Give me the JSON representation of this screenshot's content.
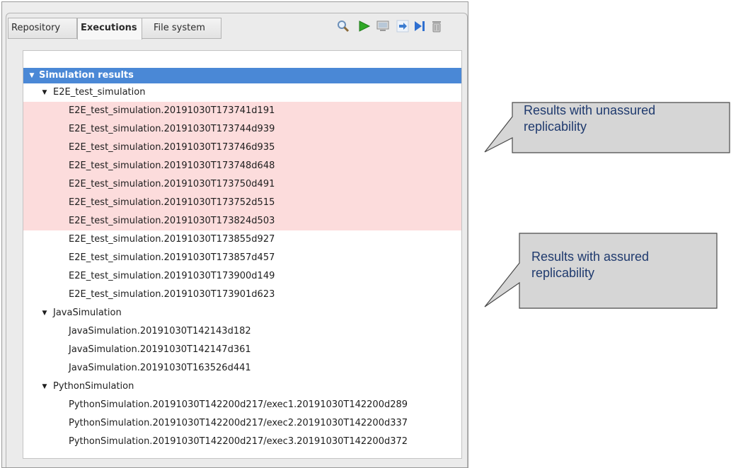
{
  "tabs": [
    {
      "label": "Repository",
      "active": false
    },
    {
      "label": "Executions",
      "active": true
    },
    {
      "label": "File system",
      "active": false
    }
  ],
  "toolbar": {
    "icons": [
      "search-icon",
      "run-icon",
      "monitor-icon",
      "step-into-icon",
      "step-next-icon",
      "trash-icon"
    ]
  },
  "tree": {
    "root": {
      "label": "Simulation results",
      "expanded": true
    },
    "groups": [
      {
        "label": "E2E_test_simulation",
        "expanded": true,
        "items": [
          {
            "label": "E2E_test_simulation.20191030T173741d191",
            "highlight": true
          },
          {
            "label": "E2E_test_simulation.20191030T173744d939",
            "highlight": true
          },
          {
            "label": "E2E_test_simulation.20191030T173746d935",
            "highlight": true
          },
          {
            "label": "E2E_test_simulation.20191030T173748d648",
            "highlight": true
          },
          {
            "label": "E2E_test_simulation.20191030T173750d491",
            "highlight": true
          },
          {
            "label": "E2E_test_simulation.20191030T173752d515",
            "highlight": true
          },
          {
            "label": "E2E_test_simulation.20191030T173824d503",
            "highlight": true
          },
          {
            "label": "E2E_test_simulation.20191030T173855d927",
            "highlight": false
          },
          {
            "label": "E2E_test_simulation.20191030T173857d457",
            "highlight": false
          },
          {
            "label": "E2E_test_simulation.20191030T173900d149",
            "highlight": false
          },
          {
            "label": "E2E_test_simulation.20191030T173901d623",
            "highlight": false
          }
        ]
      },
      {
        "label": "JavaSimulation",
        "expanded": true,
        "items": [
          {
            "label": "JavaSimulation.20191030T142143d182",
            "highlight": false
          },
          {
            "label": "JavaSimulation.20191030T142147d361",
            "highlight": false
          },
          {
            "label": "JavaSimulation.20191030T163526d441",
            "highlight": false
          }
        ]
      },
      {
        "label": "PythonSimulation",
        "expanded": true,
        "items": [
          {
            "label": "PythonSimulation.20191030T142200d217/exec1.20191030T142200d289",
            "highlight": false
          },
          {
            "label": "PythonSimulation.20191030T142200d217/exec2.20191030T142200d337",
            "highlight": false
          },
          {
            "label": "PythonSimulation.20191030T142200d217/exec3.20191030T142200d372",
            "highlight": false
          }
        ]
      }
    ]
  },
  "callouts": {
    "unassured": {
      "line1": "Results with unassured",
      "line2": "replicability"
    },
    "assured": {
      "line1": "Results with assured",
      "line2": "replicability"
    }
  },
  "colors": {
    "header_bg": "#4a88d6",
    "highlight_bg": "#fcdcdc",
    "callout_bg": "#d6d6d6",
    "callout_text": "#1f3a6e"
  }
}
